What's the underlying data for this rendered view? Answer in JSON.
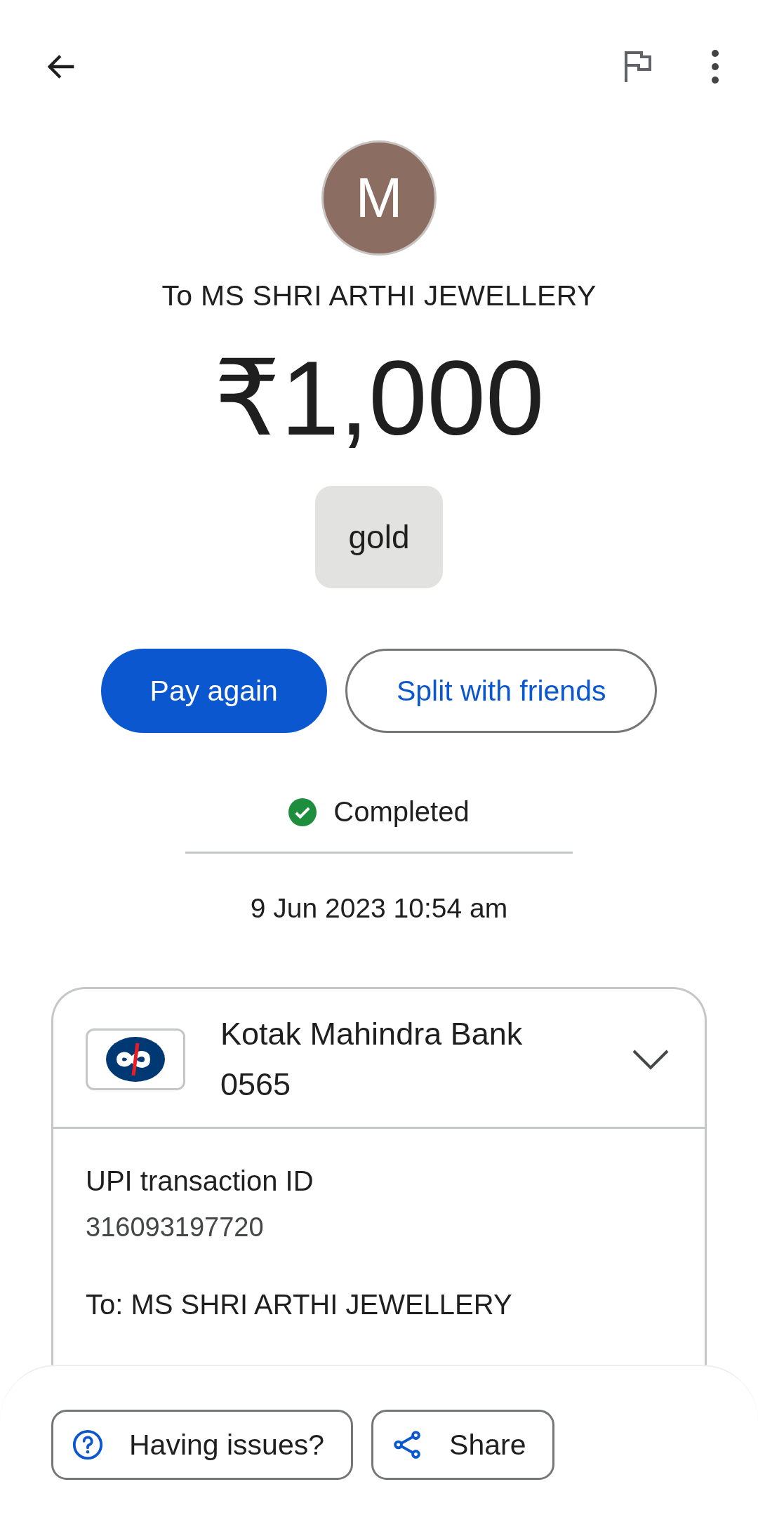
{
  "avatar": {
    "initial": "M",
    "color": "#8b6d62"
  },
  "recipient": "To MS SHRI ARTHI JEWELLERY",
  "amount": "₹1,000",
  "note": "gold",
  "actions": [
    {
      "label": "Pay again",
      "kind": "primary"
    },
    {
      "label": "Split with friends",
      "kind": "outlined"
    }
  ],
  "status": {
    "label": "Completed",
    "kind": "success"
  },
  "datetime": "9 Jun 2023 10:54 am",
  "bank_card": {
    "bank": "Kotak Mahindra Bank",
    "account": "0565",
    "expanded": false,
    "details": [
      {
        "label": "UPI transaction ID",
        "value": "316093197720"
      },
      {
        "label": "To: MS SHRI ARTHI JEWELLERY"
      }
    ]
  },
  "bottom_actions": [
    {
      "label": "Having issues?",
      "kind": "help"
    },
    {
      "label": "Share",
      "kind": "share"
    }
  ]
}
